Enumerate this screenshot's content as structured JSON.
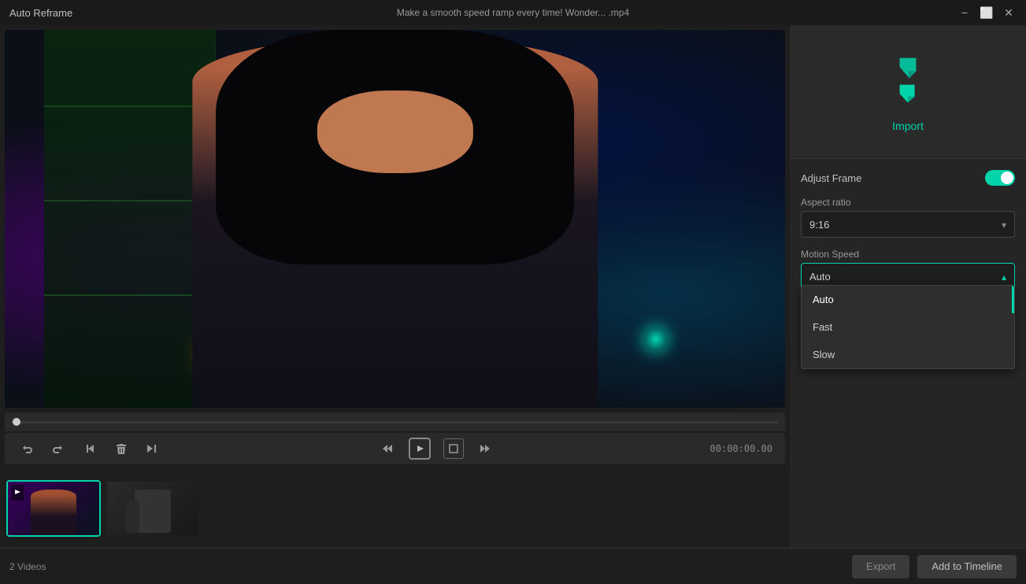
{
  "titlebar": {
    "app_name": "Auto Reframe",
    "filename": "Make a smooth speed ramp every time!  Wonder... .mp4",
    "minimize_label": "−",
    "restore_label": "⬜",
    "close_label": "✕"
  },
  "controls": {
    "undo_label": "↩",
    "redo_label": "↪",
    "prev_label": "⏮",
    "delete_label": "🗑",
    "next_label": "⏭",
    "step_back_label": "⏴",
    "play_label": "▶",
    "frame_label": "▣",
    "step_fwd_label": "⏵",
    "time_label": "00:00:00.00"
  },
  "thumbnails": {
    "video1_label": "",
    "video2_label": ""
  },
  "right_panel": {
    "import_label": "Import",
    "adjust_frame_label": "Adjust Frame",
    "aspect_ratio_label": "Aspect ratio",
    "aspect_ratio_value": "9:16",
    "motion_speed_label": "Motion Speed",
    "motion_speed_value": "Auto",
    "dropdown_options": [
      {
        "label": "Auto",
        "value": "auto"
      },
      {
        "label": "Fast",
        "value": "fast"
      },
      {
        "label": "Slow",
        "value": "slow"
      }
    ]
  },
  "footer": {
    "video_count_label": "2 Videos",
    "export_label": "Export",
    "add_timeline_label": "Add to Timeline"
  },
  "colors": {
    "accent": "#00d4aa",
    "bg_dark": "#1e1e1e",
    "bg_panel": "#252525",
    "border": "#444"
  }
}
